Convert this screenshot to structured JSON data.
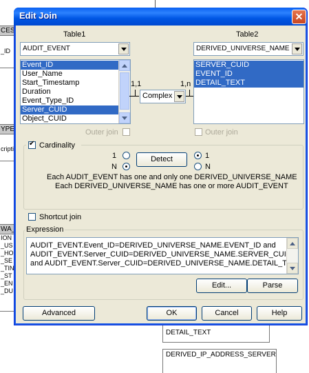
{
  "background": {
    "box1_header": "CESS",
    "box1_rows": [
      "_ID"
    ],
    "box2_header": "YPE",
    "box2_rows": [
      "cripti"
    ],
    "box3_header": "WA_",
    "box3_rows": [
      "ION",
      "_US",
      "_HO",
      "_SE",
      "_TIN",
      "_ST",
      "_EN",
      "_DU"
    ],
    "table_detail_text": "DETAIL_TEXT",
    "table_derived_ip": "DERIVED_IP_ADDRESS_SERVER"
  },
  "dialog": {
    "title": "Edit Join",
    "table1_label": "Table1",
    "table2_label": "Table2",
    "table1_selected": "AUDIT_EVENT",
    "table2_selected": "DERIVED_UNIVERSE_NAME",
    "table1_columns": [
      "Event_ID",
      "User_Name",
      "Start_Timestamp",
      "Duration",
      "Event_Type_ID",
      "Server_CUID",
      "Object_CUID"
    ],
    "table1_selected_columns": [
      0,
      5
    ],
    "table2_columns": [
      "SERVER_CUID",
      "EVENT_ID",
      "DETAIL_TEXT"
    ],
    "left_cardinality": "1,1",
    "right_cardinality": "1,n",
    "operator": "Complex",
    "outer_join_label": "Outer join",
    "cardinality_label": "Cardinality",
    "radio_one": "1",
    "radio_many": "N",
    "detect_button": "Detect",
    "cardinality_line1": "Each AUDIT_EVENT has one and only one DERIVED_UNIVERSE_NAME",
    "cardinality_line2": "Each DERIVED_UNIVERSE_NAME has one or more AUDIT_EVENT",
    "shortcut_join_label": "Shortcut join",
    "expression_label": "Expression",
    "expression_lines": [
      "AUDIT_EVENT.Event_ID=DERIVED_UNIVERSE_NAME.EVENT_ID and",
      "AUDIT_EVENT.Server_CUID=DERIVED_UNIVERSE_NAME.SERVER_CUID",
      "and AUDIT_EVENT.Server_CUID=DERIVED_UNIVERSE_NAME.DETAIL_TEXT"
    ],
    "edit_button": "Edit...",
    "parse_button": "Parse",
    "advanced_button": "Advanced",
    "ok_button": "OK",
    "cancel_button": "Cancel",
    "help_button": "Help",
    "close_icon": "close-icon"
  },
  "colors": {
    "selection": "#316ac5",
    "titlebar": "#0058e6",
    "dialog_bg": "#ece9d8"
  }
}
